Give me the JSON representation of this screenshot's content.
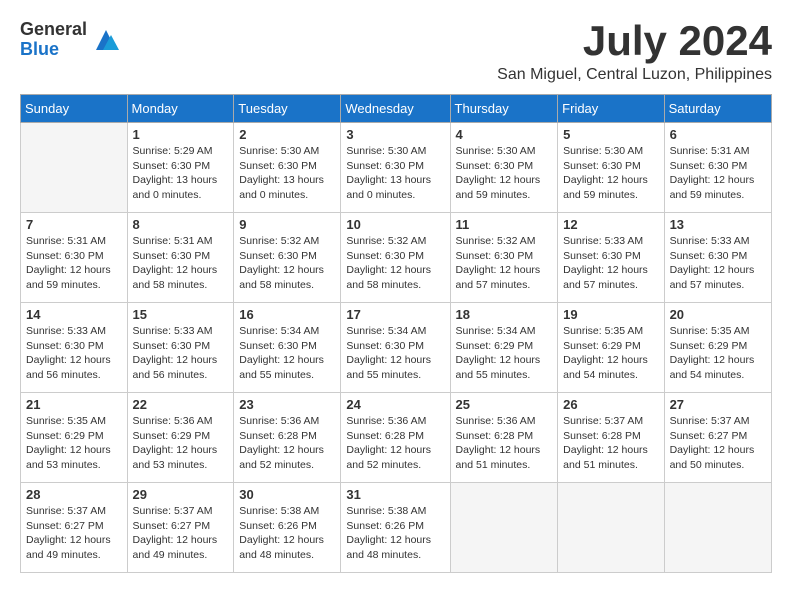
{
  "logo": {
    "general": "General",
    "blue": "Blue"
  },
  "title": "July 2024",
  "location": "San Miguel, Central Luzon, Philippines",
  "days_of_week": [
    "Sunday",
    "Monday",
    "Tuesday",
    "Wednesday",
    "Thursday",
    "Friday",
    "Saturday"
  ],
  "weeks": [
    [
      {
        "day": "",
        "info": ""
      },
      {
        "day": "1",
        "info": "Sunrise: 5:29 AM\nSunset: 6:30 PM\nDaylight: 13 hours\nand 0 minutes."
      },
      {
        "day": "2",
        "info": "Sunrise: 5:30 AM\nSunset: 6:30 PM\nDaylight: 13 hours\nand 0 minutes."
      },
      {
        "day": "3",
        "info": "Sunrise: 5:30 AM\nSunset: 6:30 PM\nDaylight: 13 hours\nand 0 minutes."
      },
      {
        "day": "4",
        "info": "Sunrise: 5:30 AM\nSunset: 6:30 PM\nDaylight: 12 hours\nand 59 minutes."
      },
      {
        "day": "5",
        "info": "Sunrise: 5:30 AM\nSunset: 6:30 PM\nDaylight: 12 hours\nand 59 minutes."
      },
      {
        "day": "6",
        "info": "Sunrise: 5:31 AM\nSunset: 6:30 PM\nDaylight: 12 hours\nand 59 minutes."
      }
    ],
    [
      {
        "day": "7",
        "info": "Sunrise: 5:31 AM\nSunset: 6:30 PM\nDaylight: 12 hours\nand 59 minutes."
      },
      {
        "day": "8",
        "info": "Sunrise: 5:31 AM\nSunset: 6:30 PM\nDaylight: 12 hours\nand 58 minutes."
      },
      {
        "day": "9",
        "info": "Sunrise: 5:32 AM\nSunset: 6:30 PM\nDaylight: 12 hours\nand 58 minutes."
      },
      {
        "day": "10",
        "info": "Sunrise: 5:32 AM\nSunset: 6:30 PM\nDaylight: 12 hours\nand 58 minutes."
      },
      {
        "day": "11",
        "info": "Sunrise: 5:32 AM\nSunset: 6:30 PM\nDaylight: 12 hours\nand 57 minutes."
      },
      {
        "day": "12",
        "info": "Sunrise: 5:33 AM\nSunset: 6:30 PM\nDaylight: 12 hours\nand 57 minutes."
      },
      {
        "day": "13",
        "info": "Sunrise: 5:33 AM\nSunset: 6:30 PM\nDaylight: 12 hours\nand 57 minutes."
      }
    ],
    [
      {
        "day": "14",
        "info": "Sunrise: 5:33 AM\nSunset: 6:30 PM\nDaylight: 12 hours\nand 56 minutes."
      },
      {
        "day": "15",
        "info": "Sunrise: 5:33 AM\nSunset: 6:30 PM\nDaylight: 12 hours\nand 56 minutes."
      },
      {
        "day": "16",
        "info": "Sunrise: 5:34 AM\nSunset: 6:30 PM\nDaylight: 12 hours\nand 55 minutes."
      },
      {
        "day": "17",
        "info": "Sunrise: 5:34 AM\nSunset: 6:30 PM\nDaylight: 12 hours\nand 55 minutes."
      },
      {
        "day": "18",
        "info": "Sunrise: 5:34 AM\nSunset: 6:29 PM\nDaylight: 12 hours\nand 55 minutes."
      },
      {
        "day": "19",
        "info": "Sunrise: 5:35 AM\nSunset: 6:29 PM\nDaylight: 12 hours\nand 54 minutes."
      },
      {
        "day": "20",
        "info": "Sunrise: 5:35 AM\nSunset: 6:29 PM\nDaylight: 12 hours\nand 54 minutes."
      }
    ],
    [
      {
        "day": "21",
        "info": "Sunrise: 5:35 AM\nSunset: 6:29 PM\nDaylight: 12 hours\nand 53 minutes."
      },
      {
        "day": "22",
        "info": "Sunrise: 5:36 AM\nSunset: 6:29 PM\nDaylight: 12 hours\nand 53 minutes."
      },
      {
        "day": "23",
        "info": "Sunrise: 5:36 AM\nSunset: 6:28 PM\nDaylight: 12 hours\nand 52 minutes."
      },
      {
        "day": "24",
        "info": "Sunrise: 5:36 AM\nSunset: 6:28 PM\nDaylight: 12 hours\nand 52 minutes."
      },
      {
        "day": "25",
        "info": "Sunrise: 5:36 AM\nSunset: 6:28 PM\nDaylight: 12 hours\nand 51 minutes."
      },
      {
        "day": "26",
        "info": "Sunrise: 5:37 AM\nSunset: 6:28 PM\nDaylight: 12 hours\nand 51 minutes."
      },
      {
        "day": "27",
        "info": "Sunrise: 5:37 AM\nSunset: 6:27 PM\nDaylight: 12 hours\nand 50 minutes."
      }
    ],
    [
      {
        "day": "28",
        "info": "Sunrise: 5:37 AM\nSunset: 6:27 PM\nDaylight: 12 hours\nand 49 minutes."
      },
      {
        "day": "29",
        "info": "Sunrise: 5:37 AM\nSunset: 6:27 PM\nDaylight: 12 hours\nand 49 minutes."
      },
      {
        "day": "30",
        "info": "Sunrise: 5:38 AM\nSunset: 6:26 PM\nDaylight: 12 hours\nand 48 minutes."
      },
      {
        "day": "31",
        "info": "Sunrise: 5:38 AM\nSunset: 6:26 PM\nDaylight: 12 hours\nand 48 minutes."
      },
      {
        "day": "",
        "info": ""
      },
      {
        "day": "",
        "info": ""
      },
      {
        "day": "",
        "info": ""
      }
    ]
  ]
}
